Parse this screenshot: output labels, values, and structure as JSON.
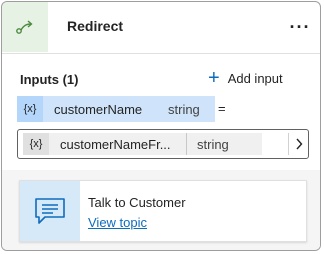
{
  "header": {
    "title": "Redirect",
    "icon": "redirect-icon",
    "more_label": "···"
  },
  "inputs": {
    "label": "Inputs (1)",
    "add_label": "Add input",
    "variable": {
      "token": "{x}",
      "name": "customerName",
      "type": "string"
    },
    "equals": "=",
    "value": {
      "token": "{x}",
      "name": "customerNameFr...",
      "type": "string"
    }
  },
  "topic": {
    "title": "Talk to Customer",
    "link": "View topic",
    "icon": "chat-message-icon"
  },
  "colors": {
    "accent": "#0f6cbd",
    "header_icon_bg": "#e6f2e4",
    "chip_bg": "#cfe4fa"
  }
}
